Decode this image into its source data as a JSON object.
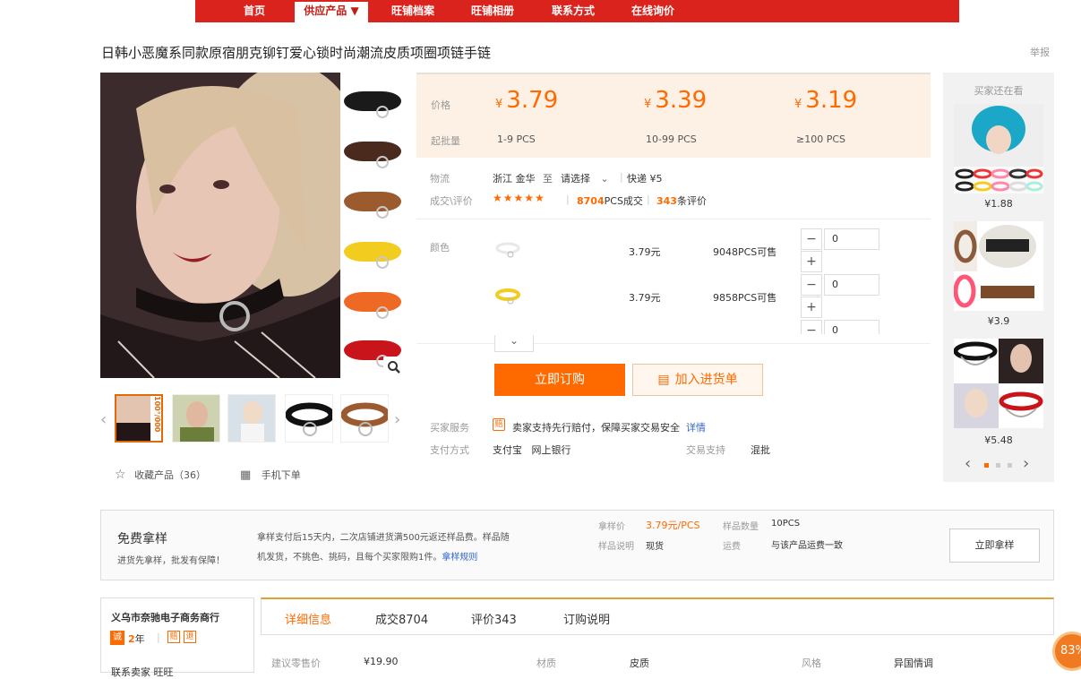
{
  "nav": {
    "items": [
      "首页",
      "供应产品 ▼",
      "旺铺档案",
      "旺铺相册",
      "联系方式",
      "在线询价"
    ]
  },
  "title": "日韩小恶魔系同款原宿朋克铆钉爱心锁时尚潮流皮质项圈项链手链",
  "report": "举报",
  "gallery": {
    "swatch_colors": [
      "#1a1a1a",
      "#4a2a1c",
      "#9b5b2e",
      "#f2cc1f",
      "#ee6a24",
      "#c8141a"
    ],
    "thumb_caption": "100°/000"
  },
  "favorite": "收藏产品（36）",
  "mobile_order": "手机下单",
  "price": {
    "label": "价格",
    "moq_label": "起批量",
    "tiers": [
      {
        "yen": "¥",
        "value": "3.79",
        "range": "1-9 PCS"
      },
      {
        "yen": "¥",
        "value": "3.39",
        "range": "10-99 PCS"
      },
      {
        "yen": "¥",
        "value": "3.19",
        "range": "≥100 PCS"
      }
    ]
  },
  "logistics": {
    "label": "物流",
    "from": "浙江 金华",
    "to": "至",
    "select": "请选择",
    "express": "快递 ¥5"
  },
  "deals": {
    "label": "成交\\评价",
    "stars": "★★★★★",
    "count": "8704",
    "count_unit": "PCS成交",
    "reviews": "343",
    "reviews_unit": "条评价"
  },
  "sku": {
    "label": "颜色",
    "rows": [
      {
        "price": "3.79元",
        "stock": "9048PCS可售",
        "qty": "0",
        "color": "#eeeeee"
      },
      {
        "price": "3.79元",
        "stock": "9858PCS可售",
        "qty": "0",
        "color": "#f2cc1f"
      },
      {
        "qty": "0"
      }
    ],
    "minus": "−",
    "plus": "+",
    "more": "⌄"
  },
  "buttons": {
    "buy": "立即订购",
    "cart": "加入进货单"
  },
  "service": {
    "label": "买家服务",
    "text": "卖家支持先行赔付，保障买家交易安全",
    "link": "详情"
  },
  "payment": {
    "label": "支付方式",
    "methods": "支付宝   网上银行",
    "trade_label": "交易支持",
    "trade": "混批"
  },
  "recommend": {
    "title": "买家还在看",
    "items": [
      {
        "price": "¥1.88"
      },
      {
        "price": "¥3.9"
      },
      {
        "price": "¥5.48"
      }
    ],
    "prev": "‹",
    "next": "›"
  },
  "sample": {
    "title": "免费拿样",
    "subtitle": "进货先拿样，批发有保障！",
    "desc1": "拿样支付后15天内，二次店铺进货满500元返还样品费。样品随",
    "desc2": "机发货，不挑色、挑码，且每个买家限购1件。",
    "rule_link": "拿样规则",
    "price_label": "拿样价",
    "price": "3.79元/PCS",
    "qty_label": "样品数量",
    "qty": "10PCS",
    "note_label": "样品说明",
    "note": "现货",
    "ship_label": "运费",
    "ship": "与该产品运费一致",
    "button": "立即拿样"
  },
  "shop": {
    "name": "义乌市奈驰电子商务商行",
    "years": "2",
    "year_unit": "年",
    "row3": "联系卖家 旺旺"
  },
  "tabs": [
    "详细信息",
    "成交8704",
    "评价343",
    "订购说明"
  ],
  "attrs": [
    {
      "k": "建议零售价",
      "v": "¥19.90"
    },
    {
      "k": "材质",
      "v": "皮质"
    },
    {
      "k": "风格",
      "v": "异国情调"
    }
  ],
  "badge": "83%"
}
